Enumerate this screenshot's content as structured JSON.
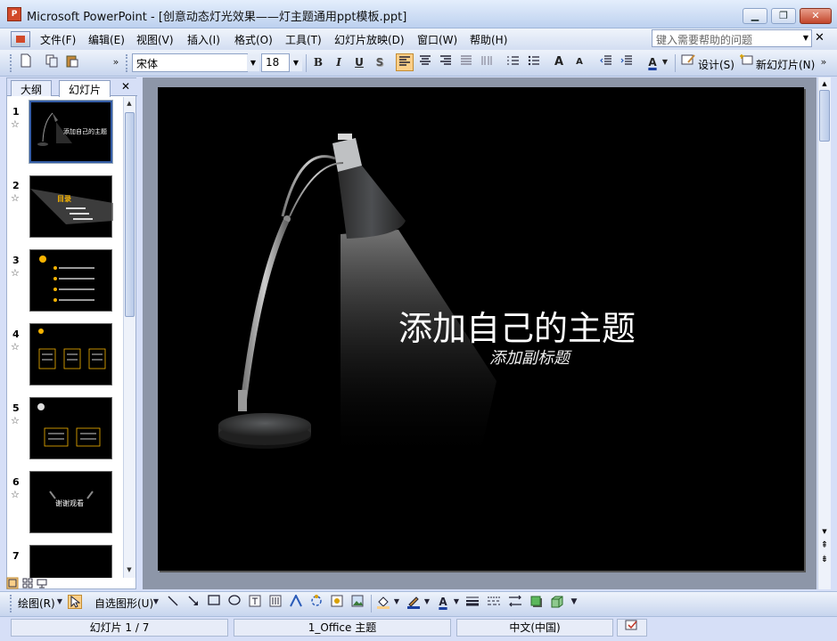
{
  "titlebar": {
    "app_icon_label": "P",
    "title": "Microsoft PowerPoint - [创意动态灯光效果——灯主题通用ppt模板.ppt]",
    "minimize_glyph": "▁",
    "restore_glyph": "❐",
    "close_glyph": "✕"
  },
  "menubar": {
    "items": [
      "文件(F)",
      "编辑(E)",
      "视图(V)",
      "插入(I)",
      "格式(O)",
      "工具(T)",
      "幻灯片放映(D)",
      "窗口(W)",
      "帮助(H)"
    ],
    "help_placeholder": "键入需要帮助的问题",
    "help_dropdown_glyph": "▼",
    "close_doc_glyph": "✕"
  },
  "toolbar": {
    "more_glyph": "»",
    "dropdown_glyph": "▼",
    "font_name": "宋体",
    "font_size": "18",
    "bold": "B",
    "italic": "I",
    "underline": "U",
    "shadow": "S",
    "increase_font": "A",
    "decrease_font": "A",
    "font_color": "A",
    "design_label": "设计(S)",
    "new_slide_label": "新幻灯片(N)"
  },
  "left_panel": {
    "tabs": [
      "大纲",
      "幻灯片"
    ],
    "close_glyph": "✕",
    "scroll_up_glyph": "▲",
    "scroll_down_glyph": "▼",
    "thumbnails": [
      {
        "num": "1",
        "text": "添加自己的主题"
      },
      {
        "num": "2",
        "text": "目录"
      },
      {
        "num": "3",
        "text": ""
      },
      {
        "num": "4",
        "text": ""
      },
      {
        "num": "5",
        "text": ""
      },
      {
        "num": "6",
        "text": "谢谢观看"
      },
      {
        "num": "7",
        "text": ""
      }
    ],
    "star_glyph": "☆"
  },
  "slide": {
    "title": "添加自己的主题",
    "subtitle": "添加副标题"
  },
  "right_scroll": {
    "up_glyph": "▲",
    "down_glyph": "▼",
    "prev_glyph": "⇞",
    "next_glyph": "⇟"
  },
  "drawbar": {
    "draw_label": "绘图(R)",
    "autoshape_label": "自选图形(U)"
  },
  "status": {
    "slide_info": "幻灯片 1 / 7",
    "theme": "1_Office 主题",
    "language": "中文(中国)"
  },
  "colors": {
    "accent": "#fbcf88",
    "slide_bg": "#000000",
    "chrome": "#d6dff7"
  }
}
